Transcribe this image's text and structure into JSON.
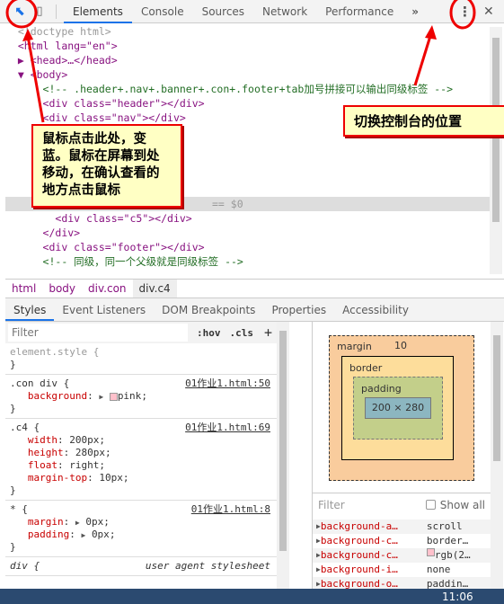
{
  "toolbar": {
    "tabs": [
      "Elements",
      "Console",
      "Sources",
      "Network",
      "Performance"
    ],
    "more": "»",
    "close": "✕",
    "menu": "⋮"
  },
  "dom": {
    "lines": [
      {
        "indent": "  ",
        "html": "doctype",
        "text": "<!doctype html>"
      },
      {
        "indent": "  ",
        "text": "<html lang=\"en\">"
      },
      {
        "indent": "  ▶ ",
        "text": "<head>…</head>"
      },
      {
        "indent": "  ▼ ",
        "text": "<body>"
      },
      {
        "indent": "      ",
        "text": "<!-- .header+.nav+.banner+.con+.footer+tab加号拼接可以输出同级标签 -->"
      },
      {
        "indent": "      ",
        "text": "<div class=\"header\"></div>"
      },
      {
        "indent": "      ",
        "text": "<div class=\"nav\"></div>"
      }
    ],
    "selected_suffix": "== $0",
    "lines_after": [
      {
        "indent": "        ",
        "text": "<div class=\"c5\"></div>"
      },
      {
        "indent": "      ",
        "text": "</div>"
      },
      {
        "indent": "      ",
        "text": "<div class=\"footer\"></div>"
      },
      {
        "indent": "      ",
        "text": "<!-- 同级，同一个父级就是同级标签 -->"
      }
    ]
  },
  "breadcrumb": [
    "html",
    "body",
    "div.con",
    "div.c4"
  ],
  "subtabs": [
    "Styles",
    "Event Listeners",
    "DOM Breakpoints",
    "Properties",
    "Accessibility"
  ],
  "styles": {
    "filter_placeholder": "Filter",
    "hov": ":hov",
    "cls": ".cls",
    "add": "+",
    "element_style": "element.style {",
    "rules": [
      {
        "selector": ".con div {",
        "source": "01作业1.html:50",
        "props": [
          [
            "background",
            "pink"
          ]
        ]
      },
      {
        "selector": ".c4 {",
        "source": "01作业1.html:69",
        "props": [
          [
            "width",
            "200px"
          ],
          [
            "height",
            "280px"
          ],
          [
            "float",
            "right"
          ],
          [
            "margin-top",
            "10px"
          ]
        ]
      },
      {
        "selector": "* {",
        "source": "01作业1.html:8",
        "props": [
          [
            "margin",
            "0px"
          ],
          [
            "padding",
            "0px"
          ]
        ]
      }
    ],
    "ua_selector": "div {",
    "ua_source": "user agent stylesheet"
  },
  "boxmodel": {
    "margin_label": "margin",
    "margin_top": "10",
    "border_label": "border",
    "padding_label": "padding",
    "content": "200 × 280",
    "dash": "–"
  },
  "computed": {
    "filter_placeholder": "Filter",
    "show_all": "Show all",
    "rows": [
      [
        "background-a…",
        "scroll"
      ],
      [
        "background-c…",
        "border…"
      ],
      [
        "background-c…",
        "rgb(2…"
      ],
      [
        "background-i…",
        "none"
      ],
      [
        "background-o…",
        "paddin…"
      ]
    ]
  },
  "annotations": {
    "note1": "鼠标点击此处，变蓝。鼠标在屏幕到处移动，在确认查看的地方点击鼠标",
    "note2": "切换控制台的位置"
  },
  "taskbar": {
    "time": "11:06"
  },
  "colors": {
    "accent": "#1a73e8",
    "annotation_red": "#e00000",
    "note_bg": "#ffffc4"
  }
}
